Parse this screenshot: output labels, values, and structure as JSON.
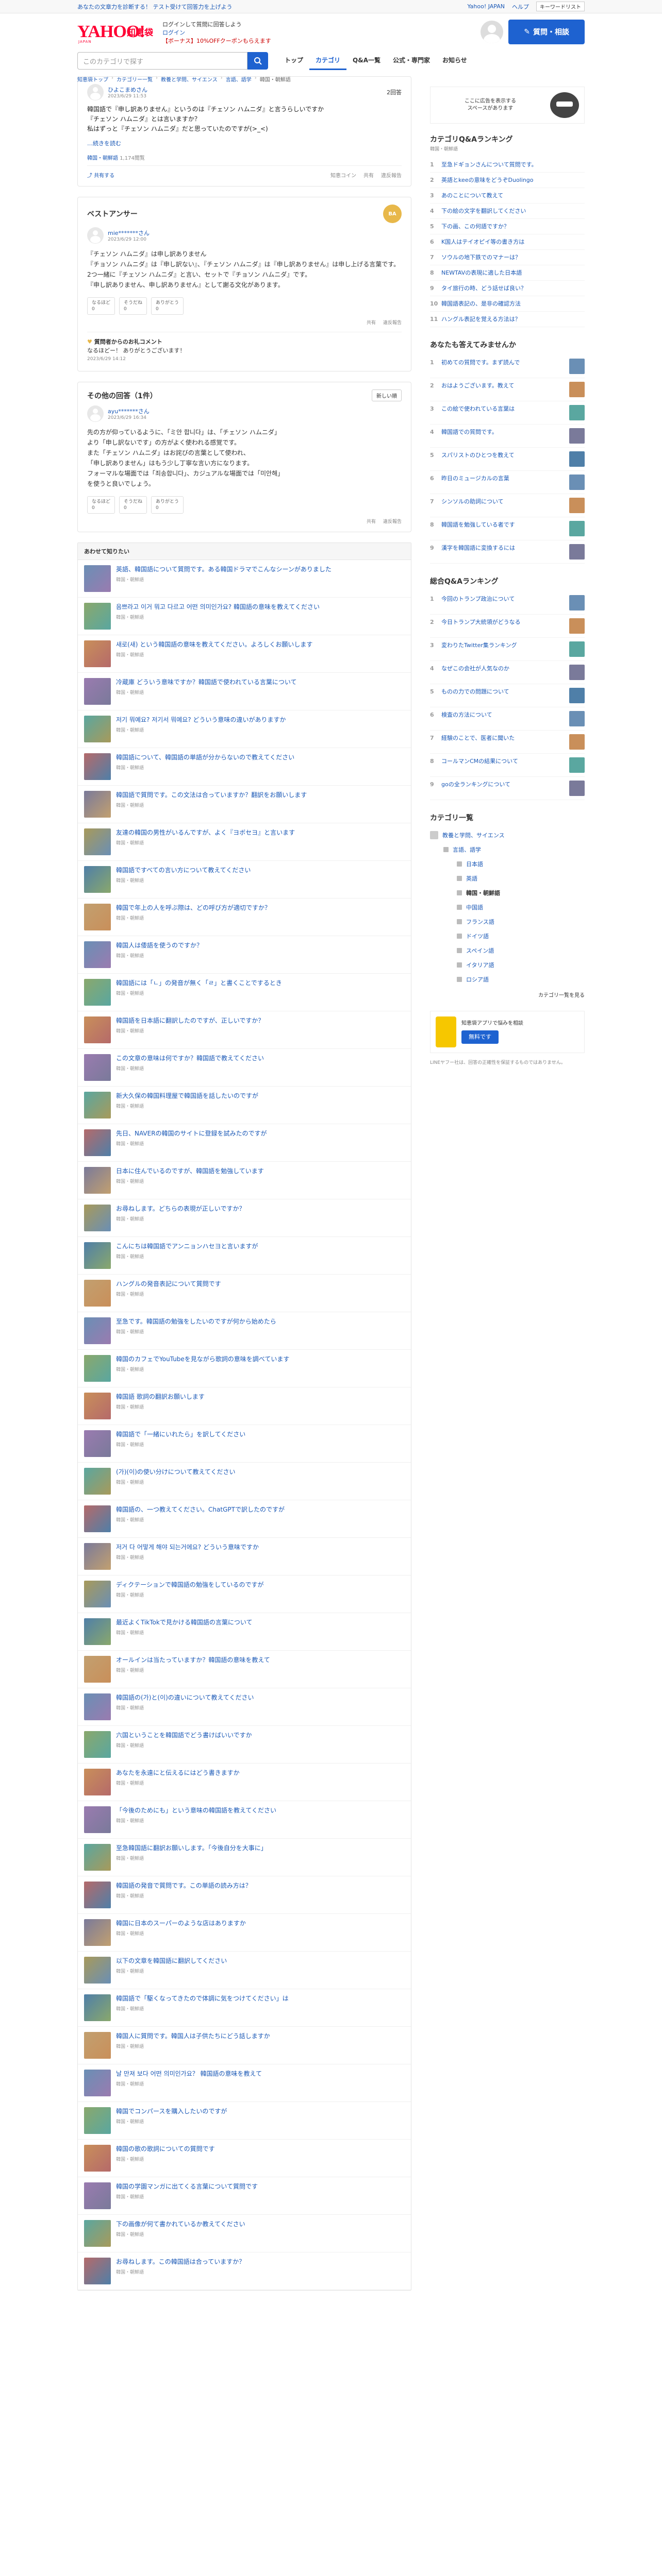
{
  "topbar": {
    "notice": "あなたの文章力を診断する！ テスト受けて回答力を上げよう",
    "links": [
      "Yahoo! JAPAN",
      "ヘルプ"
    ],
    "select": "キーワードリスト"
  },
  "header": {
    "logo_main": "YAHOO!",
    "logo_jp": "JAPAN",
    "logo_sub": "知恵袋",
    "info_line1": "ログインして質問に回答しよう",
    "info_line2": "ログイン",
    "info_line3": "【ボーナス】10%OFFクーポンもらえます",
    "ask_button": "質問・相談",
    "search_placeholder": "このカテゴリで探す",
    "nav": [
      "トップ",
      "カテゴリ",
      "Q&A一覧",
      "公式・専門家",
      "お知らせ"
    ],
    "breadcrumb": [
      "知恵袋トップ",
      "カテゴリー一覧",
      "教養と学問、サイエンス",
      "言語、語学",
      "韓国・朝鮮語"
    ]
  },
  "question": {
    "user": "ひよこまめさん",
    "date": "2023/6/29 11:53",
    "answer_count": "2回答",
    "body_lines": [
      "韓国語で『申し訳ありません』というのは『チェソン ハムニダ』と言うらしいですか",
      "『チェソン ハムニダ』とは言いますか？",
      "私はずっと『チェソン ハムニダ』だと思っていたのですが(>_<)"
    ],
    "more": "…続きを読む",
    "category": "韓国・朝鮮語",
    "views": "1,174閲覧",
    "share": "共有する",
    "actions": [
      "知恵コイン",
      "共有",
      "違反報告"
    ]
  },
  "best_answer": {
    "title": "ベストアンサー",
    "badge": "BA",
    "user": "mie*******さん",
    "date": "2023/6/29 12:00",
    "body_lines": [
      "『チェソン ハムニダ』は申し訳ありません",
      "",
      "『チョソン ハムニダ』は『申し訳ない』、『チェソン ハムニダ』は『申し訳ありません』は申し上げる言葉です。",
      "",
      "2つ一緒に『チェソン ハムニダ』と言い、セットで『チョソン ハムニダ』です。",
      "『申し訳ありません、申し訳ありません』として謝る文化があります。"
    ],
    "reactions": [
      "なるほど\n0",
      "そうだね\n0",
      "ありがとう\n0"
    ],
    "foot": [
      "共有",
      "違反報告"
    ],
    "thanks_title": "質問者からのお礼コメント",
    "thanks_body": "なるほどー！ ありがとうございます！",
    "thanks_date": "2023/6/29 14:12"
  },
  "other_answers": {
    "title": "その他の回答（1件）",
    "sort": "新しい順",
    "user": "ayu*******さん",
    "date": "2023/6/29 16:34",
    "body_lines": [
      "先の方が仰っているように、「ミ안 합니다」は、「チェソン ハムニダ」",
      "より「申し訳ないです」の方がよく使われる感覚です。",
      "",
      "また「チェソン ハムニダ」はお詫びの言葉として使われ、",
      "「申し訳ありません」はもう少し丁寧な言い方になります。",
      "",
      "フォーマルな場面では「죄송합니다」、カジュアルな場面では「미안해」",
      "を使うと良いでしょう。"
    ],
    "reactions": [
      "なるほど\n0",
      "そうだね\n0",
      "ありがとう\n0"
    ],
    "foot": [
      "共有",
      "違反報告"
    ]
  },
  "related": {
    "title": "あわせて知りたい",
    "items": [
      {
        "title": "英語、韓国語について質問です。ある韓国ドラマでこんなシーンがありました",
        "cat": "韓国・朝鮮語"
      },
      {
        "title": "음쁘라고 이거 뭐고 다르고 어떤 의미인가요? 韓国語の意味を教えてください",
        "cat": "韓国・朝鮮語"
      },
      {
        "title": "새로(새) という韓国語の意味を教えてください。よろしくお願いします",
        "cat": "韓国・朝鮮語"
      },
      {
        "title": "冷蔵庫 どういう意味ですか？韓国語で使われている言葉について",
        "cat": "韓国・朝鮮語"
      },
      {
        "title": "저기 뭐예요?  저기서 뭐예요? どういう意味の違いがありますか",
        "cat": "韓国・朝鮮語"
      },
      {
        "title": "韓国語について、韓国語の単語が分からないので教えてください",
        "cat": "韓国・朝鮮語"
      },
      {
        "title": "韓国語で質問です。この文法は合っていますか？翻訳をお願いします",
        "cat": "韓国・朝鮮語"
      },
      {
        "title": "友達の韓国の男性がいるんですが、よく『ヨボセヨ』と言います",
        "cat": "韓国・朝鮮語"
      },
      {
        "title": "韓国語ですべての言い方について教えてください",
        "cat": "韓国・朝鮮語"
      },
      {
        "title": "韓国で年上の人を呼ぶ際は、どの呼び方が適切ですか？",
        "cat": "韓国・朝鮮語"
      },
      {
        "title": "韓国人は倭語を使うのですか？",
        "cat": "韓国・朝鮮語"
      },
      {
        "title": "韓国語には「ㄴ」の発音が無く「ㄹ」と書くことでするとき",
        "cat": "韓国・朝鮮語"
      },
      {
        "title": "韓国語を日本語に翻訳したのですが、正しいですか？",
        "cat": "韓国・朝鮮語"
      },
      {
        "title": "この文章の意味は何ですか？韓国語で教えてください",
        "cat": "韓国・朝鮮語"
      },
      {
        "title": "新大久保の韓国料理屋で韓国語を話したいのですが",
        "cat": "韓国・朝鮮語"
      },
      {
        "title": "先日、NAVERの韓国のサイトに登録を試みたのですが",
        "cat": "韓国・朝鮮語"
      },
      {
        "title": "日本に住んでいるのですが、韓国語を勉強しています",
        "cat": "韓国・朝鮮語"
      },
      {
        "title": "お尋ねします。どちらの表現が正しいですか？",
        "cat": "韓国・朝鮮語"
      },
      {
        "title": "こんにちは韓国語でアンニョンハセヨと言いますが",
        "cat": "韓国・朝鮮語"
      },
      {
        "title": "ハングルの発音表記について質問です",
        "cat": "韓国・朝鮮語"
      },
      {
        "title": "至急です。韓国語の勉強をしたいのですが何から始めたら",
        "cat": "韓国・朝鮮語"
      },
      {
        "title": "韓国のカフェでYouTubeを見ながら歌詞の意味を調べています",
        "cat": "韓国・朝鮮語"
      },
      {
        "title": "韓国語 歌詞の翻訳お願いします",
        "cat": "韓国・朝鮮語"
      },
      {
        "title": "韓国語で「一緒にいれたら」を訳してください",
        "cat": "韓国・朝鮮語"
      },
      {
        "title": "(가)(이)の使い分けについて教えてください",
        "cat": "韓国・朝鮮語"
      },
      {
        "title": "韓国語の、一つ教えてください。ChatGPTで訳したのですが",
        "cat": "韓国・朝鮮語"
      },
      {
        "title": "저거 다 어떻게 해야 되는거에요? どういう意味ですか",
        "cat": "韓国・朝鮮語"
      },
      {
        "title": "ディクテーションで韓国語の勉強をしているのですが",
        "cat": "韓国・朝鮮語"
      },
      {
        "title": "最近よくTikTokで見かける韓国語の言葉について",
        "cat": "韓国・朝鮮語"
      },
      {
        "title": "オールインは当たっていますか？韓国語の意味を教えて",
        "cat": "韓国・朝鮮語"
      },
      {
        "title": "韓国語の(가)と(이)の違いについて教えてください",
        "cat": "韓国・朝鮮語"
      },
      {
        "title": "六国ということを韓国語でどう書けばいいですか",
        "cat": "韓国・朝鮮語"
      },
      {
        "title": "あなたを永遠にと伝えるにはどう書きますか",
        "cat": "韓国・朝鮮語"
      },
      {
        "title": "「今後のためにも」という意味の韓国語を教えてください",
        "cat": "韓国・朝鮮語"
      },
      {
        "title": "至急韓国語に翻訳お願いします。「今後自分を大事に」",
        "cat": "韓国・朝鮮語"
      },
      {
        "title": "韓国語の発音で質問です。この単語の読み方は？",
        "cat": "韓国・朝鮮語"
      },
      {
        "title": "韓国に日本のスーパーのような店はありますか",
        "cat": "韓国・朝鮮語"
      },
      {
        "title": "以下の文章を韓国語に翻訳してください",
        "cat": "韓国・朝鮮語"
      },
      {
        "title": "韓国語で「駆くなってきたので体調に気をつけてください」は",
        "cat": "韓国・朝鮮語"
      },
      {
        "title": "韓国人に質問です。韓国人は子供たちにどう話しますか",
        "cat": "韓国・朝鮮語"
      },
      {
        "title": "날 만져 보다 어떤 의미인가요？ 韓国語の意味を教えて",
        "cat": "韓国・朝鮮語"
      },
      {
        "title": "韓国でコンパースを購入したいのですが",
        "cat": "韓国・朝鮮語"
      },
      {
        "title": "韓国の歌の歌詞についての質問です",
        "cat": "韓国・朝鮮語"
      },
      {
        "title": "韓国の学園マンガに出てくる言葉について質問です",
        "cat": "韓国・朝鮮語"
      },
      {
        "title": "下の画像が何て書かれているか教えてください",
        "cat": "韓国・朝鮮語"
      },
      {
        "title": "お尋ねします。この韓国語は合っていますか？",
        "cat": "韓国・朝鮮語"
      }
    ]
  },
  "sidebar": {
    "ad_text": "ここに広告を表示する\nスペースがあります",
    "ranking_title": "カテゴリQ&Aランキング",
    "ranking_sub": "韓国・朝鮮語",
    "ranking": [
      "至急ドギョンさんについて質問です。",
      "英語とkeeの意味をどうぞDuolingo",
      "あのことについて教えて",
      "下の絵の文字を翻訳してください",
      "下の画、この何語ですか？",
      "K国人はテイオピイ等の書き方は",
      "ソウルの地下鉄でのマナーは？",
      "NEWTAVの表現に適した日本語",
      "タイ旅行の時、どう話せば良い？",
      "韓国語表記の、是非の確認方法",
      "ハングル表記を覚える方法は？"
    ],
    "unanswered_title": "あなたも答えてみませんか",
    "unanswered": [
      "初めての質問です。まず読んで",
      "おはようございます。教えて",
      "この絵で使われている言葉は",
      "韓国語での質問です。",
      "スパリストのひとつを教えて",
      "昨日のミュージカルの言葉",
      "シンソルの助詞について",
      "韓国語を勉強している者です",
      "漢字を韓国語に変換するには"
    ],
    "total_ranking_title": "総合Q&Aランキング",
    "total_ranking": [
      "今回のトランプ政治について",
      "今日トランプ大統領がどうなる",
      "変わりたTwitter集ランキング",
      "なぜこの会社が人気なのか",
      "ものの力での問題について",
      "検査の方法について",
      "経験のことで、医者に聞いた",
      "コールマンCMの結果について",
      "goの全ランキングについて"
    ],
    "cat_title": "カテゴリ一覧",
    "cat_main": "教養と学問、サイエンス",
    "cat_sub": "言語、語学",
    "cat_items": [
      "日本語",
      "英語",
      "韓国・朝鮮語",
      "中国語",
      "フランス語",
      "ドイツ語",
      "スペイン語",
      "イタリア語",
      "ロシア語"
    ],
    "cat_more": "カテゴリ一覧を見る",
    "app_title": "知恵袋アプリで悩みを相談",
    "app_button": "無料です",
    "note": "LINEヤフー社は、回答の正確性を保証するものではありません。"
  },
  "colors": {
    "accent": "#1e62d0",
    "brand": "#ff0033"
  }
}
